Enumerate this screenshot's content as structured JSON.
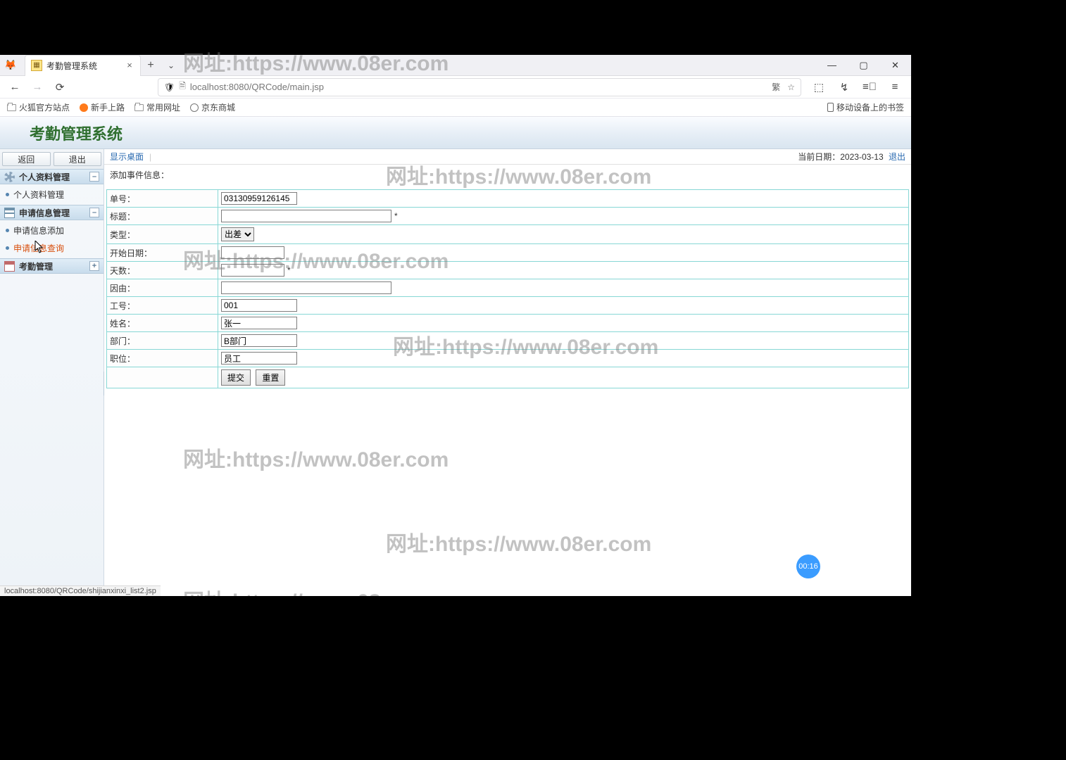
{
  "browser": {
    "tab_title": "考勤管理系统",
    "url_display": "localhost:8080/QRCode/main.jsp"
  },
  "bookmarks": {
    "b1": "火狐官方站点",
    "b2": "新手上路",
    "b3": "常用网址",
    "b4": "京东商城",
    "mobile": "移动设备上的书签"
  },
  "app": {
    "header_title": "考勤管理系统"
  },
  "sidebar": {
    "btn_back": "返回",
    "btn_exit": "退出",
    "sections": {
      "s1": {
        "title": "个人资料管理",
        "links": {
          "l1": "个人资料管理"
        }
      },
      "s2": {
        "title": "申请信息管理",
        "links": {
          "l1": "申请信息添加",
          "l2": "申请信息查询"
        }
      },
      "s3": {
        "title": "考勤管理"
      }
    }
  },
  "crumb": {
    "show_desktop": "显示桌面",
    "date_label": "当前日期：",
    "date_value": "2023-03-13",
    "logout": "退出"
  },
  "form": {
    "title": "添加事件信息：",
    "labels": {
      "no": "单号：",
      "title": "标题：",
      "type": "类型：",
      "start": "开始日期：",
      "days": "天数：",
      "reason": "因由：",
      "empno": "工号：",
      "name": "姓名：",
      "dept": "部门：",
      "pos": "职位："
    },
    "type_option": "出差",
    "values": {
      "no": "03130959126145",
      "title": "",
      "start": "",
      "days": "",
      "reason": "",
      "empno": "001",
      "name": "张一",
      "dept": "B部门",
      "pos": "员工"
    },
    "btn_submit": "提交",
    "btn_reset": "重置"
  },
  "status_text": "localhost:8080/QRCode/shijianxinxi_list2.jsp",
  "timer": "00:16",
  "watermark": "网址:https://www.08er.com"
}
